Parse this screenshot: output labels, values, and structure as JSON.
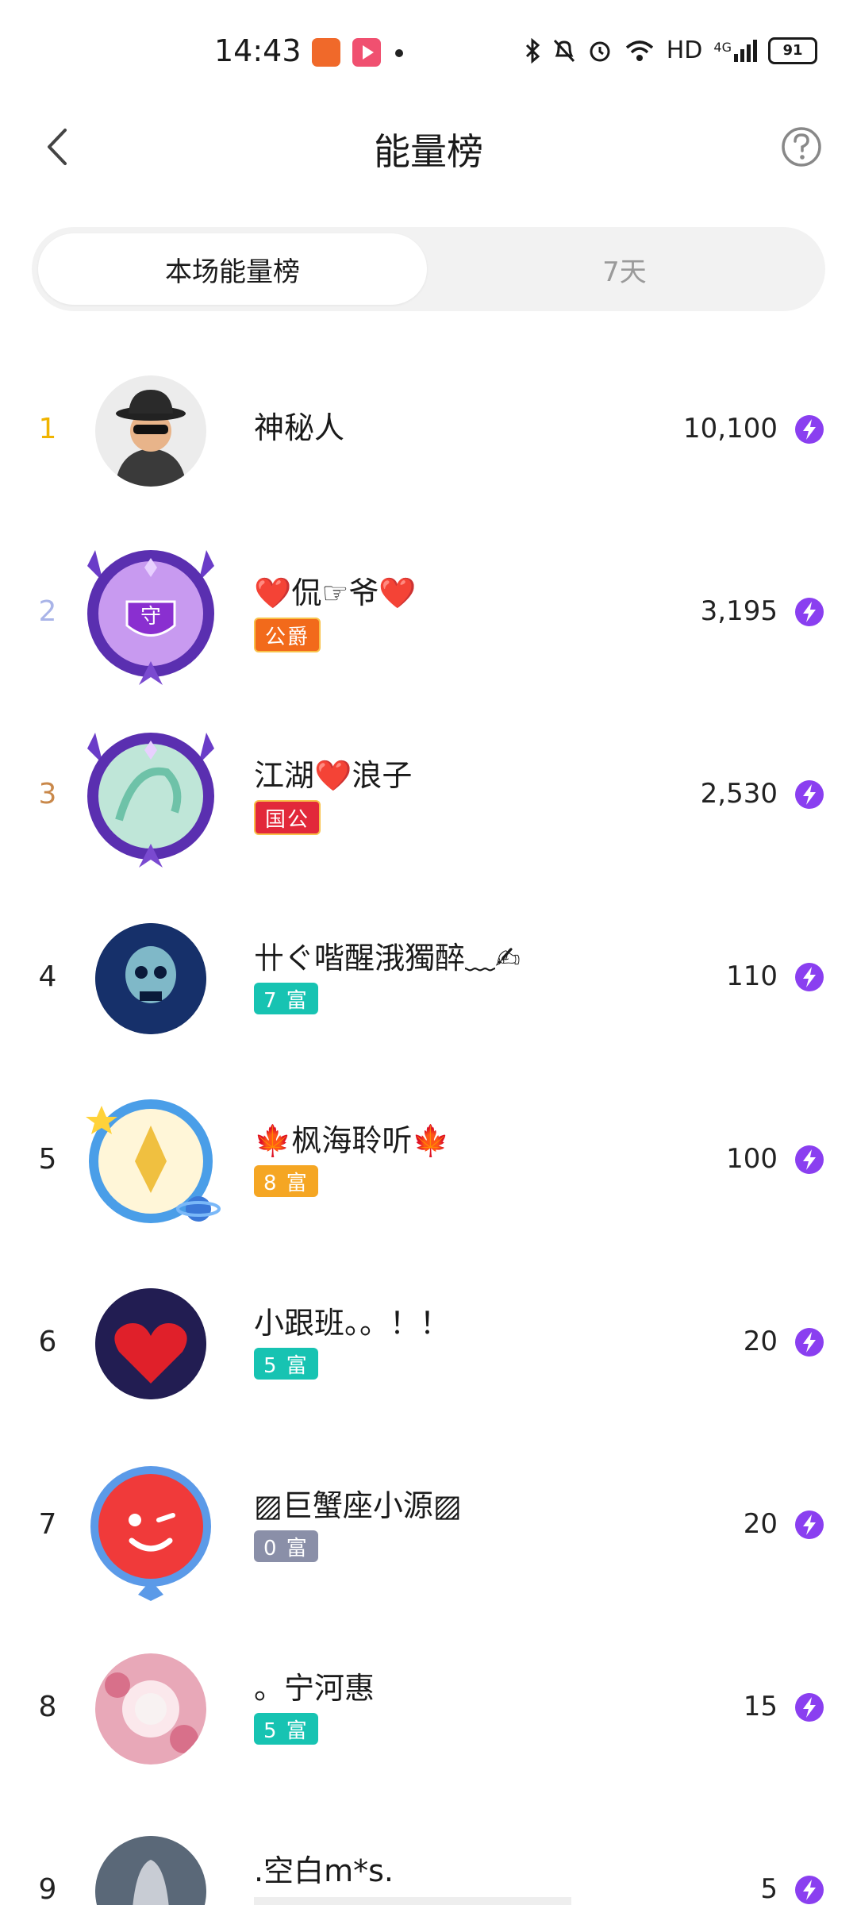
{
  "status_bar": {
    "time": "14:43",
    "network": "HD",
    "signal": "4G",
    "battery": "91"
  },
  "header": {
    "title": "能量榜"
  },
  "tabs": [
    {
      "label": "本场能量榜",
      "active": true
    },
    {
      "label": "7天",
      "active": false
    }
  ],
  "ranking": [
    {
      "rank": "1",
      "name": "神秘人",
      "badge": "",
      "score": "10,100"
    },
    {
      "rank": "2",
      "name": "❤️侃☞爷❤️",
      "badge": "公爵",
      "score": "3,195"
    },
    {
      "rank": "3",
      "name": "江湖❤️浪子",
      "badge": "国公",
      "score": "2,530"
    },
    {
      "rank": "4",
      "name": "卄ぐ喈醒涐獨醉﹏✍",
      "badge": "7 富",
      "score": "110"
    },
    {
      "rank": "5",
      "name": "🍁枫海聆听🍁",
      "badge": "8 富",
      "score": "100"
    },
    {
      "rank": "6",
      "name": "小跟班。。！！",
      "badge": "5 富",
      "score": "20"
    },
    {
      "rank": "7",
      "name": "▨巨蟹座小源▨",
      "badge": "0 富",
      "score": "20"
    },
    {
      "rank": "8",
      "name": "。宁河惠",
      "badge": "5 富",
      "score": "15"
    },
    {
      "rank": "9",
      "name": ".空白m*s.",
      "badge": "",
      "score": "5"
    }
  ],
  "colors": {
    "rank1": "#f0b400",
    "rank2": "#a9b4e8",
    "rank3": "#c9884a",
    "badge_teal": "#17c3b2",
    "badge_orange": "#f5a623",
    "badge_gray": "#8a8fa8",
    "energy": "#8a3ff0"
  }
}
